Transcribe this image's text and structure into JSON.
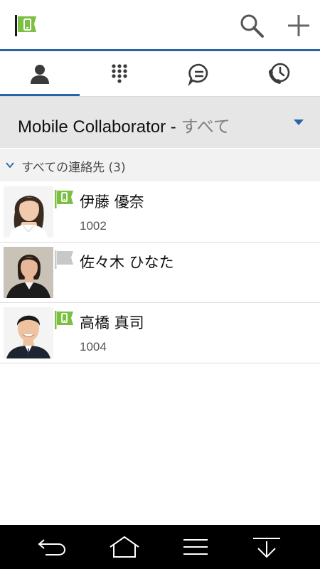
{
  "app": {
    "logo_icon": "green-flag-phone-icon",
    "search_icon": "search-icon",
    "add_icon": "plus-icon",
    "accent_color": "#2a63a5",
    "presence_green": "#7cc043"
  },
  "tabs": [
    {
      "id": "contacts",
      "icon": "person-icon",
      "active": true
    },
    {
      "id": "dialpad",
      "icon": "dialpad-icon",
      "active": false
    },
    {
      "id": "chat",
      "icon": "chat-icon",
      "active": false
    },
    {
      "id": "history",
      "icon": "call-history-icon",
      "active": false
    }
  ],
  "filter": {
    "source": "Mobile Collaborator -",
    "scope": "すべて"
  },
  "group": {
    "label": "すべての連絡先 (3)"
  },
  "contacts": [
    {
      "name": "伊藤 優奈",
      "extension": "1002",
      "presence": "green-phone-flag-icon"
    },
    {
      "name": "佐々木 ひなた",
      "extension": "",
      "presence": "grey-flag-icon"
    },
    {
      "name": "高橋 真司",
      "extension": "1004",
      "presence": "green-phone-flag-icon"
    }
  ],
  "system_nav": [
    "back-icon",
    "home-icon",
    "menu-icon",
    "collapse-icon"
  ]
}
